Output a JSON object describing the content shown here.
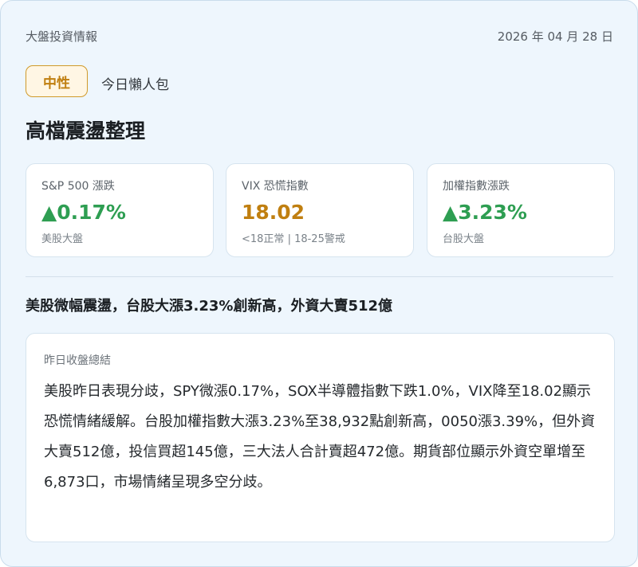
{
  "header": {
    "title": "大盤投資情報",
    "date": "2026 年 04 月 28 日"
  },
  "sentiment": {
    "badge": "中性",
    "tag": "今日懶人包",
    "badge_color": "#c07f10"
  },
  "headline": "高檔震盪整理",
  "metrics": [
    {
      "label": "S&P 500 漲跌",
      "value": "▲0.17%",
      "sub": "美股大盤",
      "color": "#2e9e52"
    },
    {
      "label": "VIX 恐慌指數",
      "value": "18.02",
      "sub": "<18正常 | 18-25警戒",
      "color": "#c07f10"
    },
    {
      "label": "加權指數漲跌",
      "value": "▲3.23%",
      "sub": "台股大盤",
      "color": "#2e9e52"
    }
  ],
  "summary": "美股微幅震盪，台股大漲3.23%創新高，外資大賣512億",
  "panel": {
    "title": "昨日收盤總結",
    "body": "美股昨日表現分歧，SPY微漲0.17%，SOX半導體指數下跌1.0%，VIX降至18.02顯示恐慌情緒緩解。台股加權指數大漲3.23%至38,932點創新高，0050漲3.39%，但外資大賣512億，投信買超145億，三大法人合計賣超472億。期貨部位顯示外資空單增至6,873口，市場情緒呈現多空分歧。"
  }
}
